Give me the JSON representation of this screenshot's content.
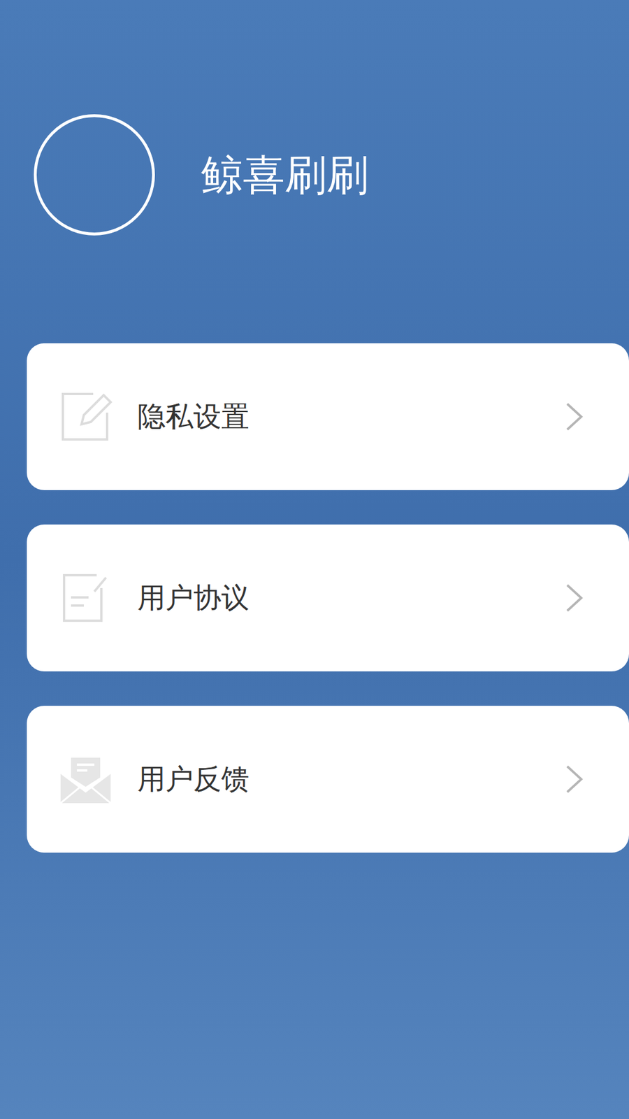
{
  "app": {
    "title": "鲸喜刷刷"
  },
  "menu": [
    {
      "label": "隐私设置"
    },
    {
      "label": "用户协议"
    },
    {
      "label": "用户反馈"
    }
  ]
}
